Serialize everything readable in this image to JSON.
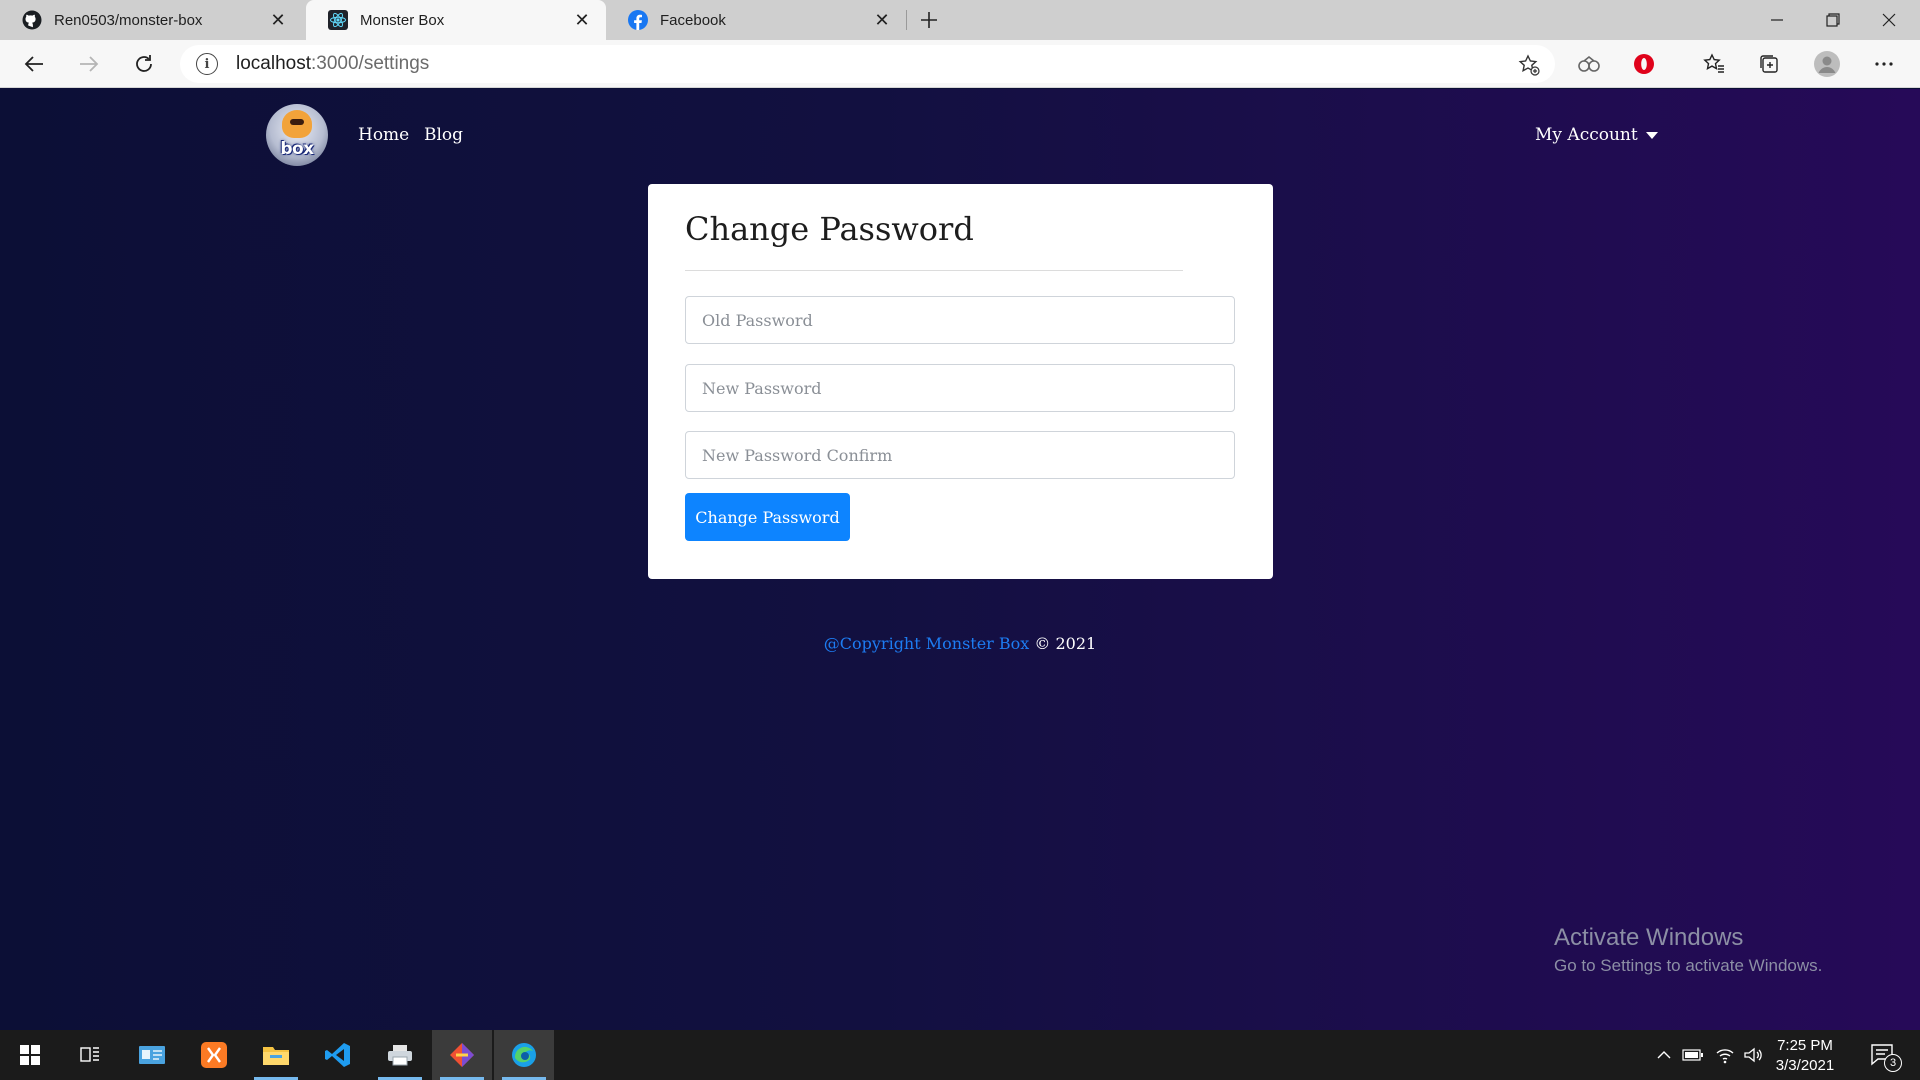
{
  "browser": {
    "tabs": [
      {
        "title": "Ren0503/monster-box",
        "icon": "github-icon",
        "active": false
      },
      {
        "title": "Monster Box",
        "icon": "react-icon",
        "active": true
      },
      {
        "title": "Facebook",
        "icon": "facebook-icon",
        "active": false
      }
    ],
    "url": {
      "host": "localhost",
      "rest": ":3000/settings"
    }
  },
  "site": {
    "logo_text": "box",
    "nav": {
      "home": "Home",
      "blog": "Blog",
      "account": "My Account"
    }
  },
  "form": {
    "title": "Change Password",
    "old_password_placeholder": "Old Password",
    "new_password_placeholder": "New Password",
    "confirm_placeholder": "New Password Confirm",
    "submit_label": "Change Password"
  },
  "footer": {
    "link_text": "@Copyright Monster Box",
    "suffix": " © 2021"
  },
  "watermark": {
    "title": "Activate Windows",
    "subtitle": "Go to Settings to activate Windows."
  },
  "taskbar": {
    "time": "7:25 PM",
    "date": "3/3/2021",
    "notifications": "3"
  },
  "colors": {
    "accent": "#0d84ff",
    "footer_link": "#1d7cf2",
    "page_bg_left": "#0c0f36",
    "page_bg_right": "#260a58"
  }
}
